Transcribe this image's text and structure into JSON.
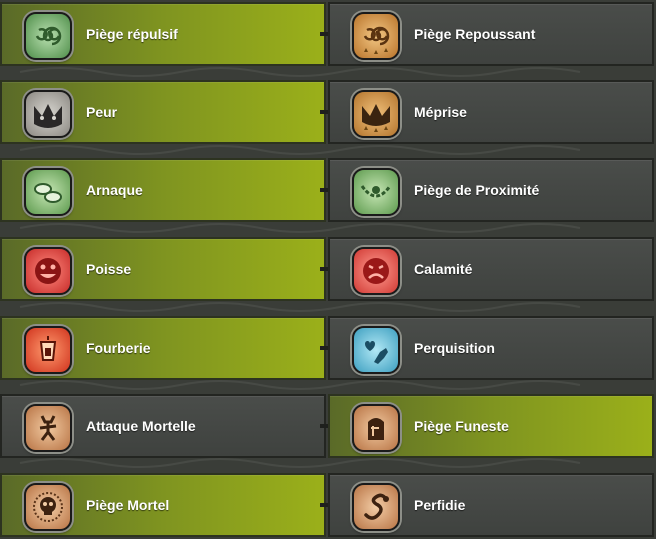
{
  "colors": {
    "selected_accent": "#9bb01a",
    "panel": "#444744",
    "background": "#3a3d38"
  },
  "rows": [
    {
      "left": {
        "label": "Piège répulsif",
        "icon": "spiral-trap-icon",
        "selected": true
      },
      "right": {
        "label": "Piège Repoussant",
        "icon": "spiral-trap-icon",
        "selected": false
      }
    },
    {
      "left": {
        "label": "Peur",
        "icon": "mask-icon",
        "selected": true
      },
      "right": {
        "label": "Méprise",
        "icon": "mask-icon",
        "selected": false
      }
    },
    {
      "left": {
        "label": "Arnaque",
        "icon": "coins-icon",
        "selected": true
      },
      "right": {
        "label": "Piège de Proximité",
        "icon": "chain-trap-icon",
        "selected": false
      }
    },
    {
      "left": {
        "label": "Poisse",
        "icon": "grin-face-icon",
        "selected": true
      },
      "right": {
        "label": "Calamité",
        "icon": "sad-face-icon",
        "selected": false
      }
    },
    {
      "left": {
        "label": "Fourberie",
        "icon": "lantern-icon",
        "selected": true
      },
      "right": {
        "label": "Perquisition",
        "icon": "hand-heart-icon",
        "selected": false
      }
    },
    {
      "left": {
        "label": "Attaque Mortelle",
        "icon": "tribal-figure-icon",
        "selected": false
      },
      "right": {
        "label": "Piège Funeste",
        "icon": "tombstone-icon",
        "selected": true
      }
    },
    {
      "left": {
        "label": "Piège Mortel",
        "icon": "skull-icon",
        "selected": true
      },
      "right": {
        "label": "Perfidie",
        "icon": "snake-icon",
        "selected": false
      }
    }
  ]
}
